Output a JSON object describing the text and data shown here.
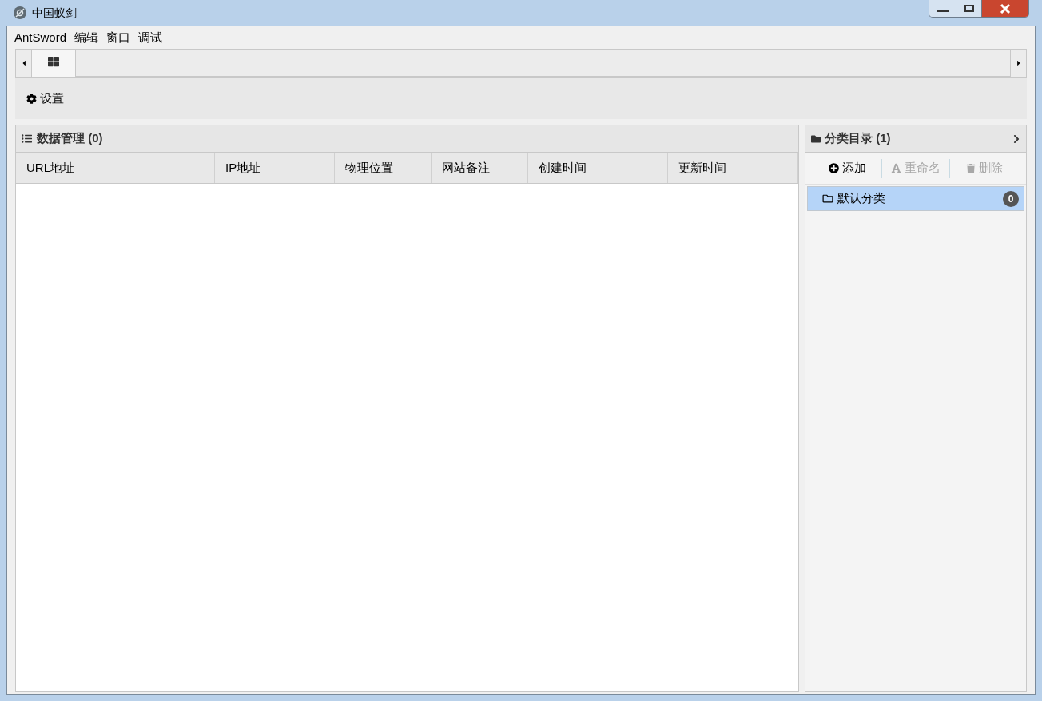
{
  "window": {
    "title": "中国蚁剑"
  },
  "menu": [
    {
      "label": "AntSword"
    },
    {
      "label": "编辑"
    },
    {
      "label": "窗口"
    },
    {
      "label": "调试"
    }
  ],
  "tabs": [
    {
      "kind": "home",
      "selected": true
    }
  ],
  "toolbar": [
    {
      "label": "设置"
    }
  ],
  "data_panel": {
    "title": "数据管理 (0)",
    "columns": [
      "URL地址",
      "IP地址",
      "物理位置",
      "网站备注",
      "创建时间",
      "更新时间"
    ]
  },
  "category_panel": {
    "title": "分类目录 (1)",
    "actions": [
      {
        "kind": "add",
        "label": "添加",
        "disabled": false
      },
      {
        "kind": "rename",
        "label": "重命名",
        "disabled": true
      },
      {
        "kind": "delete",
        "label": "删除",
        "disabled": true
      }
    ],
    "items": [
      {
        "label": "默认分类",
        "count": "0",
        "selected": true
      }
    ]
  }
}
